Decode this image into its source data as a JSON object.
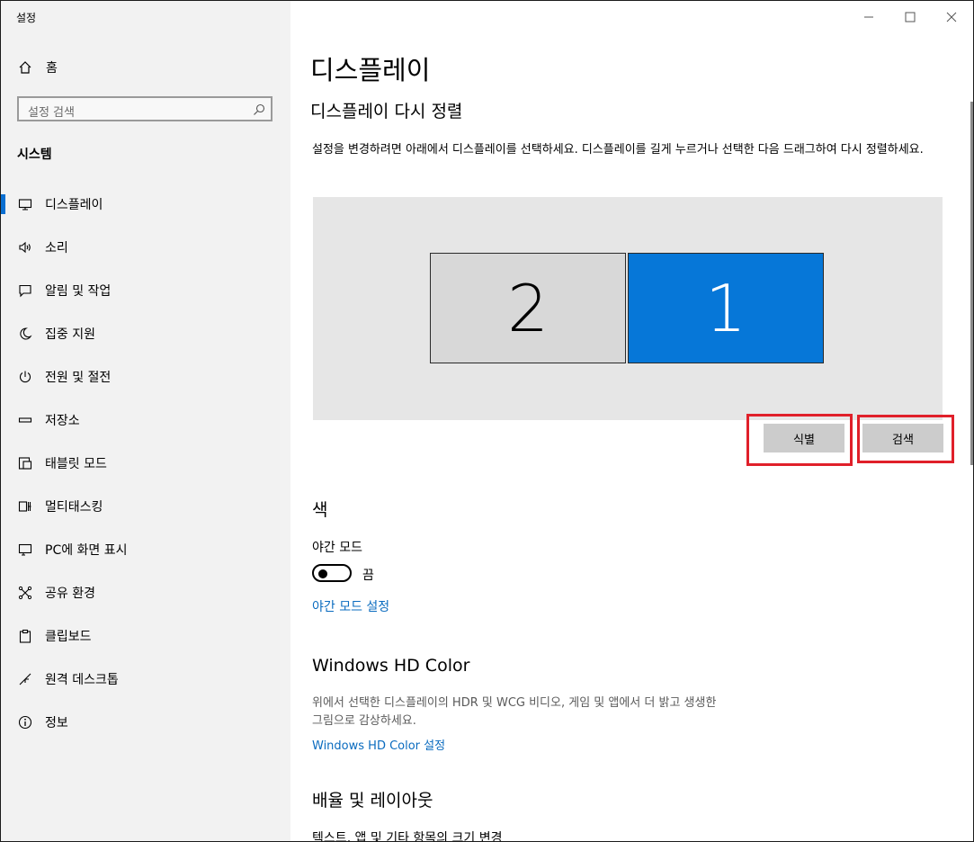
{
  "window": {
    "title": "설정",
    "minimize_icon": "minimize-icon",
    "maximize_icon": "maximize-icon",
    "close_icon": "close-icon"
  },
  "sidebar": {
    "home_label": "홈",
    "search_placeholder": "설정 검색",
    "section_title": "시스템",
    "items": [
      {
        "label": "디스플레이",
        "icon": "monitor-icon",
        "selected": true
      },
      {
        "label": "소리",
        "icon": "speaker-icon"
      },
      {
        "label": "알림 및 작업",
        "icon": "notification-icon"
      },
      {
        "label": "집중 지원",
        "icon": "moon-icon"
      },
      {
        "label": "전원 및 절전",
        "icon": "power-icon"
      },
      {
        "label": "저장소",
        "icon": "storage-icon"
      },
      {
        "label": "태블릿 모드",
        "icon": "tablet-icon"
      },
      {
        "label": "멀티태스킹",
        "icon": "multitask-icon"
      },
      {
        "label": "PC에 화면 표시",
        "icon": "project-icon"
      },
      {
        "label": "공유 환경",
        "icon": "share-icon"
      },
      {
        "label": "클립보드",
        "icon": "clipboard-icon"
      },
      {
        "label": "원격 데스크톱",
        "icon": "remote-icon"
      },
      {
        "label": "정보",
        "icon": "info-icon"
      }
    ]
  },
  "main": {
    "title": "디스플레이",
    "rearrange_heading": "디스플레이 다시 정렬",
    "rearrange_desc": "설정을 변경하려면 아래에서 디스플레이를 선택하세요. 디스플레이를 길게 누르거나 선택한 다음 드래그하여 다시 정렬하세요.",
    "monitors": [
      {
        "number": "2",
        "selected": false
      },
      {
        "number": "1",
        "selected": true
      }
    ],
    "identify_button": "식별",
    "detect_button": "검색",
    "color_heading": "색",
    "night_light_label": "야간 모드",
    "night_light_state": "끔",
    "night_light_settings_link": "야간 모드 설정",
    "hdr_heading": "Windows HD Color",
    "hdr_desc": "위에서 선택한 디스플레이의 HDR 및 WCG 비디오, 게임 및 앱에서 더 밝고 생생한 그림으로 감상하세요.",
    "hdr_link": "Windows HD Color 설정",
    "scale_heading": "배율 및 레이아웃",
    "scale_sublabel": "텍스트, 앱 및 기타 항목의 크기 변경"
  },
  "colors": {
    "accent": "#0677d8",
    "link": "#0a6bbf",
    "highlight_box": "#e0202a",
    "sidebar_bg": "#f2f2f2"
  }
}
